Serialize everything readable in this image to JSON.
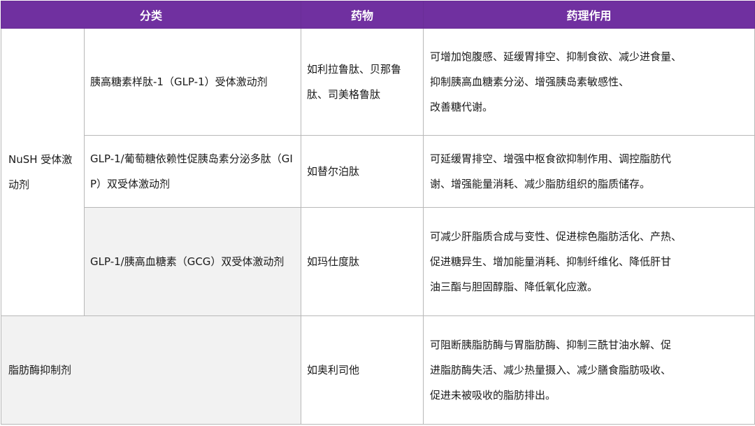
{
  "header": {
    "category": "分类",
    "drug": "药物",
    "effect": "药理作用"
  },
  "group_label": "NuSH 受体激动剂",
  "rows": [
    {
      "subcategory": "胰高糖素样肽-1（GLP-1）受体激动剂",
      "drug": "如利拉鲁肽、贝那鲁肽、司美格鲁肽",
      "effect_lines": [
        "可增加饱腹感、延缓胃排空、抑制食欲、减少进食量、",
        "抑制胰高血糖素分泌、增强胰岛素敏感性、",
        "改善糖代谢。"
      ]
    },
    {
      "subcategory": "GLP-1/葡萄糖依赖性促胰岛素分泌多肽（GIP）双受体激动剂",
      "drug": "如替尔泊肽",
      "effect_lines": [
        "可延缓胃排空、增强中枢食欲抑制作用、调控脂肪代",
        "谢、增强能量消耗、减少脂肪组织的脂质储存。"
      ]
    },
    {
      "subcategory": "GLP-1/胰高血糖素（GCG）双受体激动剂",
      "drug": "如玛仕度肽",
      "effect_lines": [
        "可减少肝脂质合成与变性、促进棕色脂肪活化、产热、",
        "促进糖异生、增加能量消耗、抑制纤维化、降低肝甘",
        "油三酯与胆固醇脂、降低氧化应激。"
      ]
    }
  ],
  "lipase_row": {
    "category": "脂肪酶抑制剂",
    "drug": "如奥利司他",
    "effect_lines": [
      "可阻断胰脂肪酶与胃脂肪酶、抑制三酰甘油水解、促",
      "进脂肪酶失活、减少热量摄入、减少膳食脂肪吸收、",
      "促进未被吸收的脂肪排出。"
    ]
  }
}
